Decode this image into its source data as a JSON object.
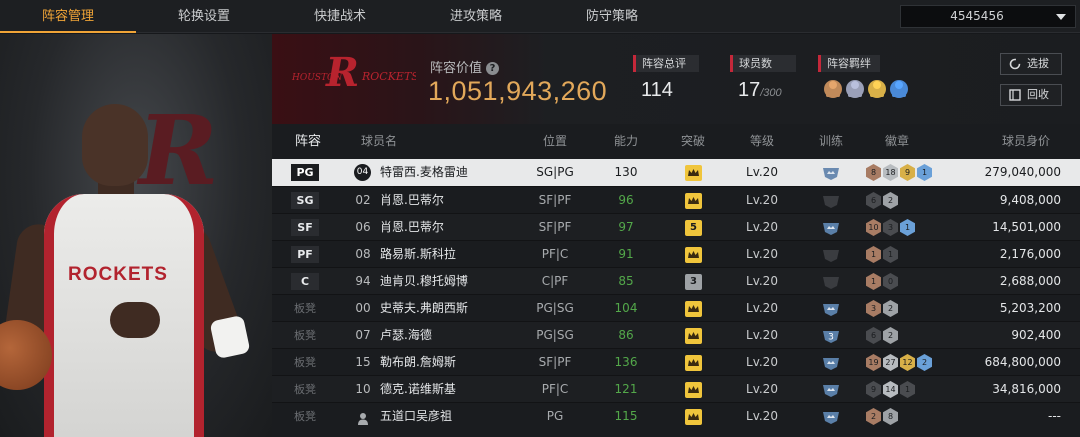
{
  "nav": {
    "tabs": [
      "阵容管理",
      "轮换设置",
      "快捷战术",
      "进攻策略",
      "防守策略"
    ],
    "active_tab": 0,
    "account": "4545456"
  },
  "header": {
    "team_value_label": "阵容价值",
    "team_value": "1,051,943,260",
    "total_rating_label": "阵容总评",
    "total_rating": "114",
    "player_count_label": "球员数",
    "player_count": "17",
    "player_count_max": "/300",
    "bonds_label": "阵容羁绊",
    "select_button": "选拔",
    "recycle_button": "回收",
    "bond_icon_colors": [
      "#c08a5a",
      "#9aa0b8",
      "#d8b048",
      "#4a8ad8"
    ]
  },
  "table": {
    "headers": [
      "阵容",
      "球员名",
      "位置",
      "能力",
      "突破",
      "等级",
      "训练",
      "徽章",
      "球员身价"
    ],
    "rows": [
      {
        "slot": "PG",
        "number": "04",
        "name": "特雷西.麦格雷迪",
        "position": "SG|PG",
        "ability": "130",
        "breakthrough": "crown",
        "break_color": "#f0c53c",
        "level": "Lv.20",
        "training": "gold",
        "badges": [
          {
            "t": "8",
            "c": "#a87c64"
          },
          {
            "t": "18",
            "c": "#b8bcc0"
          },
          {
            "t": "9",
            "c": "#d8b048"
          },
          {
            "t": "1",
            "c": "#6aa0d8"
          }
        ],
        "value": "279,040,000",
        "selected": true,
        "starter": true,
        "user": false
      },
      {
        "slot": "SG",
        "number": "02",
        "name": "肖恩.巴蒂尔",
        "position": "SF|PF",
        "ability": "96",
        "breakthrough": "crown",
        "break_color": "#f0c53c",
        "level": "Lv.20",
        "training": "none",
        "badges": [
          {
            "t": "6",
            "c": "#4a4c50"
          },
          {
            "t": "2",
            "c": "#9ea2a6"
          }
        ],
        "value": "9,408,000",
        "selected": false,
        "starter": true,
        "user": false
      },
      {
        "slot": "SF",
        "number": "06",
        "name": "肖恩.巴蒂尔",
        "position": "SF|PF",
        "ability": "97",
        "breakthrough": "5",
        "break_color": "#f0c53c",
        "level": "Lv.20",
        "training": "blue",
        "badges": [
          {
            "t": "10",
            "c": "#a87c64"
          },
          {
            "t": "3",
            "c": "#4a4c50"
          },
          {
            "t": "1",
            "c": "#6aa0d8"
          }
        ],
        "value": "14,501,000",
        "selected": false,
        "starter": true,
        "user": false
      },
      {
        "slot": "PF",
        "number": "08",
        "name": "路易斯.斯科拉",
        "position": "PF|C",
        "ability": "91",
        "breakthrough": "crown",
        "break_color": "#f0c53c",
        "level": "Lv.20",
        "training": "none",
        "badges": [
          {
            "t": "1",
            "c": "#a87c64"
          },
          {
            "t": "1",
            "c": "#4a4c50"
          }
        ],
        "value": "2,176,000",
        "selected": false,
        "starter": true,
        "user": false
      },
      {
        "slot": "C",
        "number": "94",
        "name": "迪肯贝.穆托姆博",
        "position": "C|PF",
        "ability": "85",
        "breakthrough": "3",
        "break_color": "#9ea2a6",
        "level": "Lv.20",
        "training": "none",
        "badges": [
          {
            "t": "1",
            "c": "#a87c64"
          },
          {
            "t": "0",
            "c": "#4a4c50"
          }
        ],
        "value": "2,688,000",
        "selected": false,
        "starter": true,
        "user": false
      },
      {
        "slot": "板凳",
        "number": "00",
        "name": "史蒂夫.弗朗西斯",
        "position": "PG|SG",
        "ability": "104",
        "breakthrough": "crown",
        "break_color": "#f0c53c",
        "level": "Lv.20",
        "training": "blue",
        "badges": [
          {
            "t": "3",
            "c": "#a87c64"
          },
          {
            "t": "2",
            "c": "#9ea2a6"
          }
        ],
        "value": "5,203,200",
        "selected": false,
        "starter": false,
        "user": false
      },
      {
        "slot": "板凳",
        "number": "07",
        "name": "卢瑟.海德",
        "position": "PG|SG",
        "ability": "86",
        "breakthrough": "crown",
        "break_color": "#f0c53c",
        "level": "Lv.20",
        "training": "3",
        "badges": [
          {
            "t": "6",
            "c": "#4a4c50"
          },
          {
            "t": "2",
            "c": "#9ea2a6"
          }
        ],
        "value": "902,400",
        "selected": false,
        "starter": false,
        "user": false
      },
      {
        "slot": "板凳",
        "number": "15",
        "name": "勒布朗.詹姆斯",
        "position": "SF|PF",
        "ability": "136",
        "breakthrough": "crown",
        "break_color": "#f0c53c",
        "level": "Lv.20",
        "training": "blue",
        "badges": [
          {
            "t": "19",
            "c": "#a87c64"
          },
          {
            "t": "27",
            "c": "#b8bcc0"
          },
          {
            "t": "12",
            "c": "#d8b048"
          },
          {
            "t": "2",
            "c": "#6aa0d8"
          }
        ],
        "value": "684,800,000",
        "selected": false,
        "starter": false,
        "user": false
      },
      {
        "slot": "板凳",
        "number": "10",
        "name": "德克.诺维斯基",
        "position": "PF|C",
        "ability": "121",
        "breakthrough": "crown",
        "break_color": "#f0c53c",
        "level": "Lv.20",
        "training": "blue",
        "badges": [
          {
            "t": "9",
            "c": "#4a4c50"
          },
          {
            "t": "14",
            "c": "#b8bcc0"
          },
          {
            "t": "1",
            "c": "#4a4c50"
          }
        ],
        "value": "34,816,000",
        "selected": false,
        "starter": false,
        "user": false
      },
      {
        "slot": "板凳",
        "number": "",
        "name": "五道口吴彦祖",
        "position": "PG",
        "ability": "115",
        "breakthrough": "crown",
        "break_color": "#f0c53c",
        "level": "Lv.20",
        "training": "blue",
        "badges": [
          {
            "t": "2",
            "c": "#a87c64"
          },
          {
            "t": "8",
            "c": "#9ea2a6"
          }
        ],
        "value": "---",
        "selected": false,
        "starter": false,
        "user": true
      }
    ]
  }
}
